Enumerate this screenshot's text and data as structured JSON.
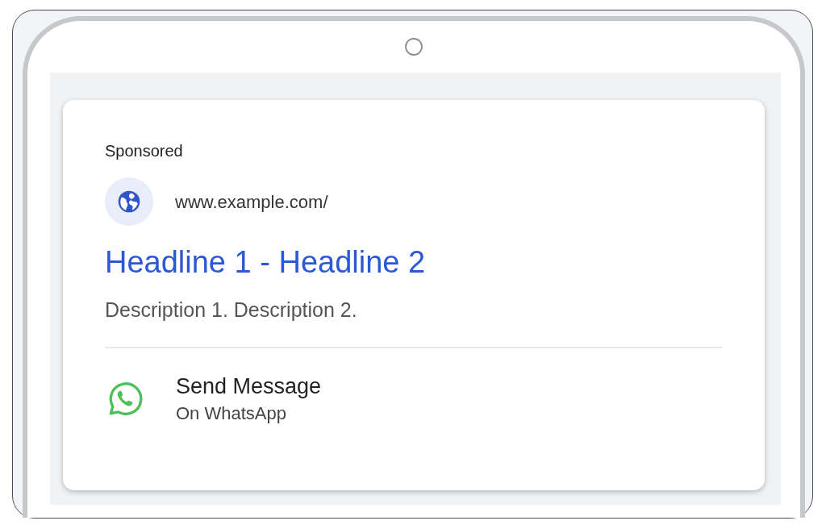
{
  "ad": {
    "label": "Sponsored",
    "url": "www.example.com/",
    "headline": "Headline 1 - Headline 2",
    "description": "Description 1. Description 2.",
    "action": {
      "title": "Send Message",
      "subtitle": "On WhatsApp"
    }
  }
}
